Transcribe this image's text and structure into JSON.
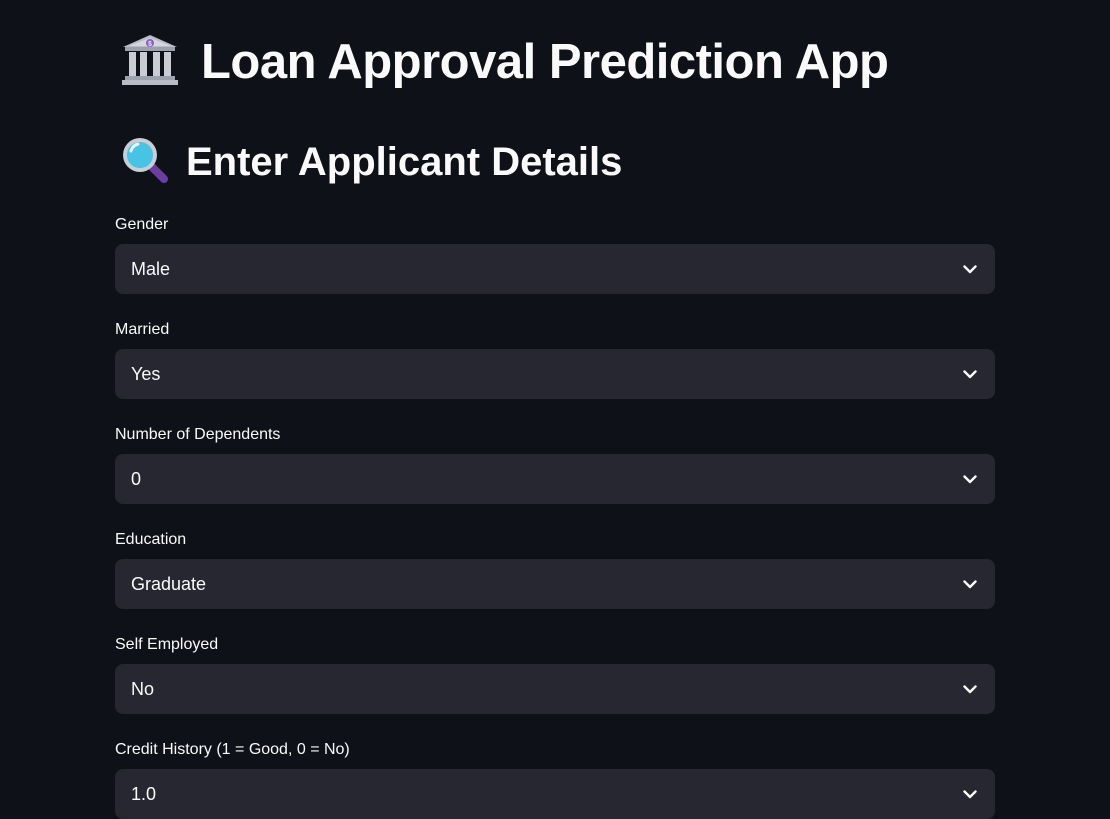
{
  "app": {
    "title": "Loan Approval Prediction App",
    "title_icon": "bank-icon",
    "section_title": "Enter Applicant Details",
    "section_icon": "magnifying-glass-icon"
  },
  "form": {
    "fields": [
      {
        "label": "Gender",
        "value": "Male"
      },
      {
        "label": "Married",
        "value": "Yes"
      },
      {
        "label": "Number of Dependents",
        "value": "0"
      },
      {
        "label": "Education",
        "value": "Graduate"
      },
      {
        "label": "Self Employed",
        "value": "No"
      },
      {
        "label": "Credit History (1 = Good, 0 = No)",
        "value": "1.0"
      }
    ]
  },
  "colors": {
    "background": "#0e1117",
    "input_background": "#262730",
    "text": "#fafafa"
  }
}
